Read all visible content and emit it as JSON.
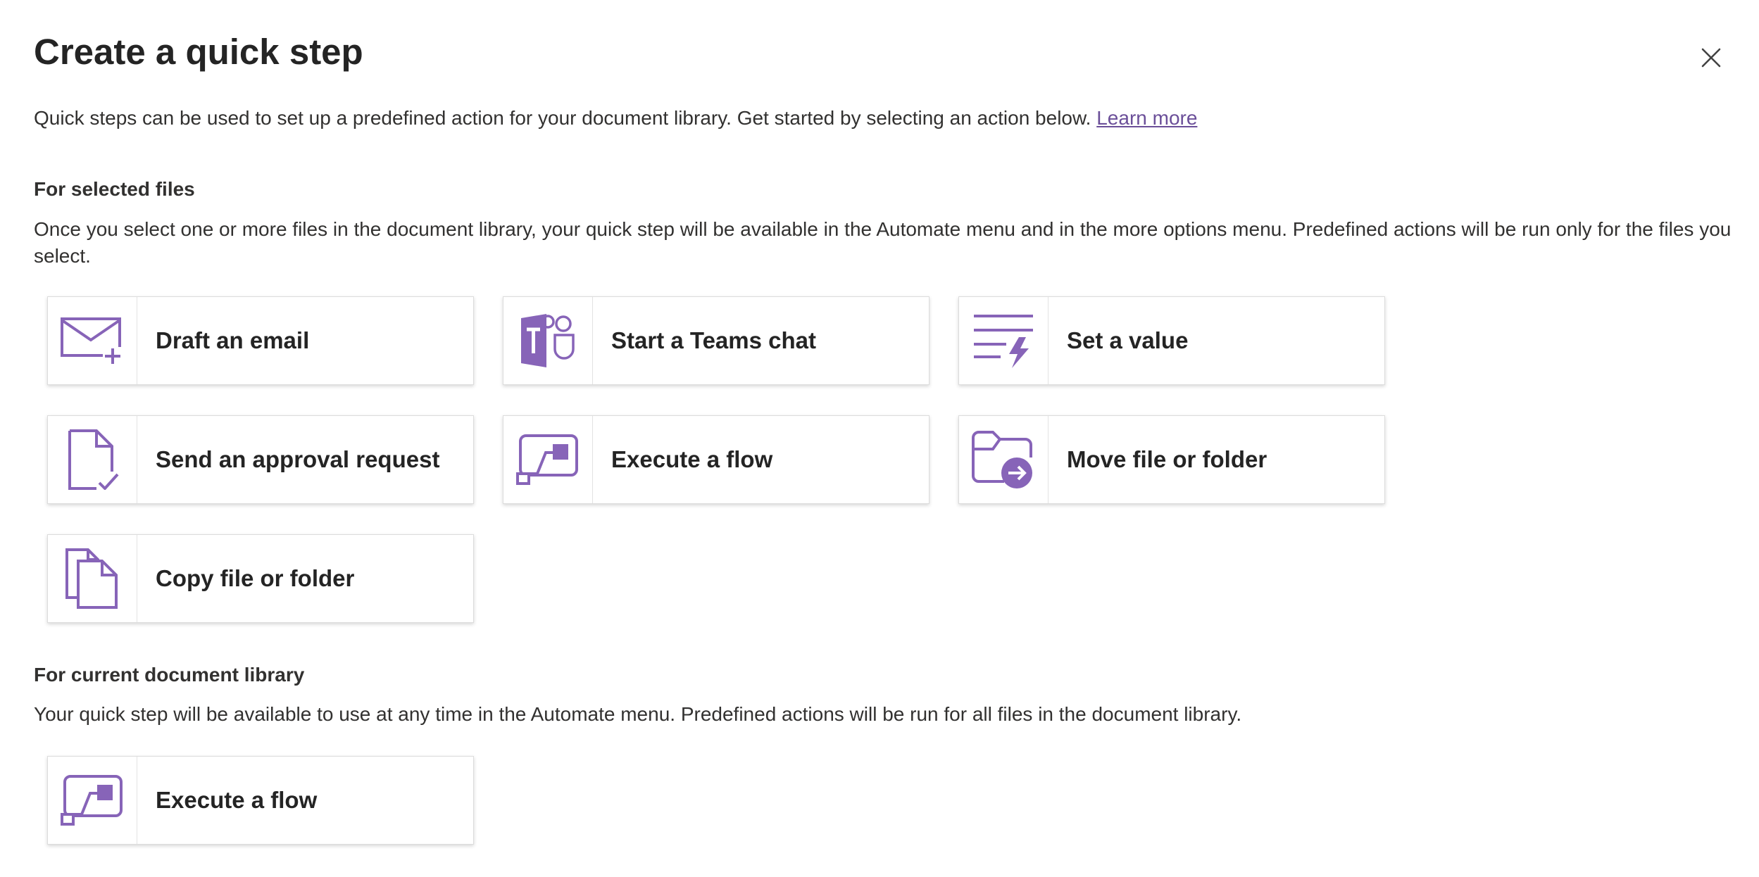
{
  "dialog": {
    "title": "Create a quick step",
    "close_icon": "close-icon",
    "intro_text": "Quick steps can be used to set up a predefined action for your document library. Get started by selecting an action below.",
    "learn_more": "Learn more"
  },
  "colors": {
    "accent": "#8764b8",
    "link": "#6b4f99",
    "text": "#242424"
  },
  "selected_files": {
    "heading": "For selected files",
    "description": "Once you select one or more files in the document library, your quick step will be available in the Automate menu and in the more options menu. Predefined actions will be run only for the files you select.",
    "actions": [
      {
        "label": "Draft an email",
        "icon": "email-add-icon"
      },
      {
        "label": "Start a Teams chat",
        "icon": "teams-icon"
      },
      {
        "label": "Set a value",
        "icon": "set-value-icon"
      },
      {
        "label": "Send an approval request",
        "icon": "document-check-icon"
      },
      {
        "label": "Execute a flow",
        "icon": "flow-icon"
      },
      {
        "label": "Move file or folder",
        "icon": "folder-move-icon"
      },
      {
        "label": "Copy file or folder",
        "icon": "copy-icon"
      }
    ]
  },
  "current_library": {
    "heading": "For current document library",
    "description": "Your quick step will be available to use at any time in the Automate menu. Predefined actions will be run for all files in the document library.",
    "actions": [
      {
        "label": "Execute a flow",
        "icon": "flow-icon"
      }
    ]
  }
}
